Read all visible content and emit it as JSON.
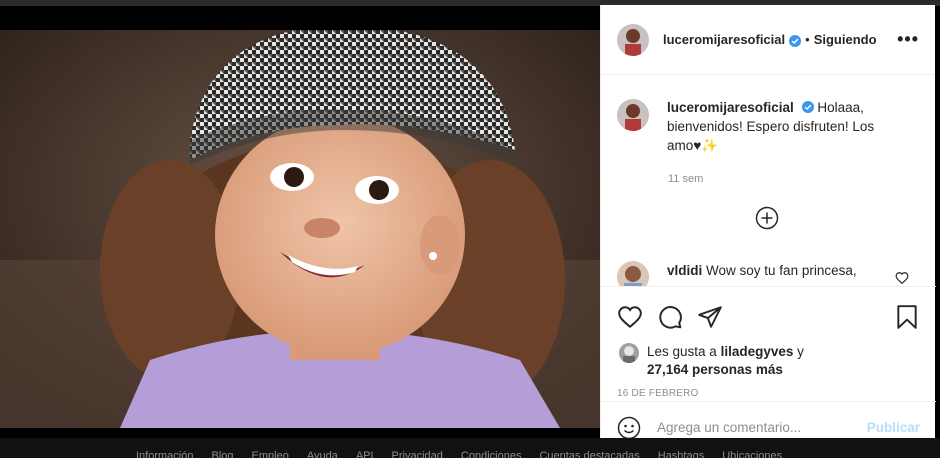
{
  "post": {
    "username": "luceromijaresoficial",
    "separator": "•",
    "follow_state": "Siguiendo",
    "more_label": "•••"
  },
  "caption": {
    "username": "luceromijaresoficial",
    "text": "Holaaa, bienvenidos! Espero disfruten! Los amo♥✨",
    "time": "11 sem"
  },
  "comment": {
    "username": "vldidi",
    "text": "Wow soy tu fan princesa,"
  },
  "likes": {
    "prefix": "Les gusta a",
    "liker": "liladegyves",
    "conjunction": "y",
    "count_text": "27,164 personas más"
  },
  "date": "16 DE FEBRERO",
  "add_comment": {
    "placeholder": "Agrega un comentario...",
    "publish_label": "Publicar"
  },
  "footer": {
    "links": [
      "Información",
      "Blog",
      "Empleo",
      "Ayuda",
      "API",
      "Privacidad",
      "Condiciones",
      "Cuentas destacadas",
      "Hashtags",
      "Ubicaciones"
    ]
  },
  "colors": {
    "verified": "#3897f0",
    "publish_disabled": "#b2dffc",
    "muted": "#8e8e8e"
  },
  "icons": [
    "verified-badge-icon",
    "more-options-icon",
    "add-circle-icon",
    "heart-icon",
    "comment-icon",
    "share-icon",
    "bookmark-icon",
    "emoji-icon"
  ]
}
